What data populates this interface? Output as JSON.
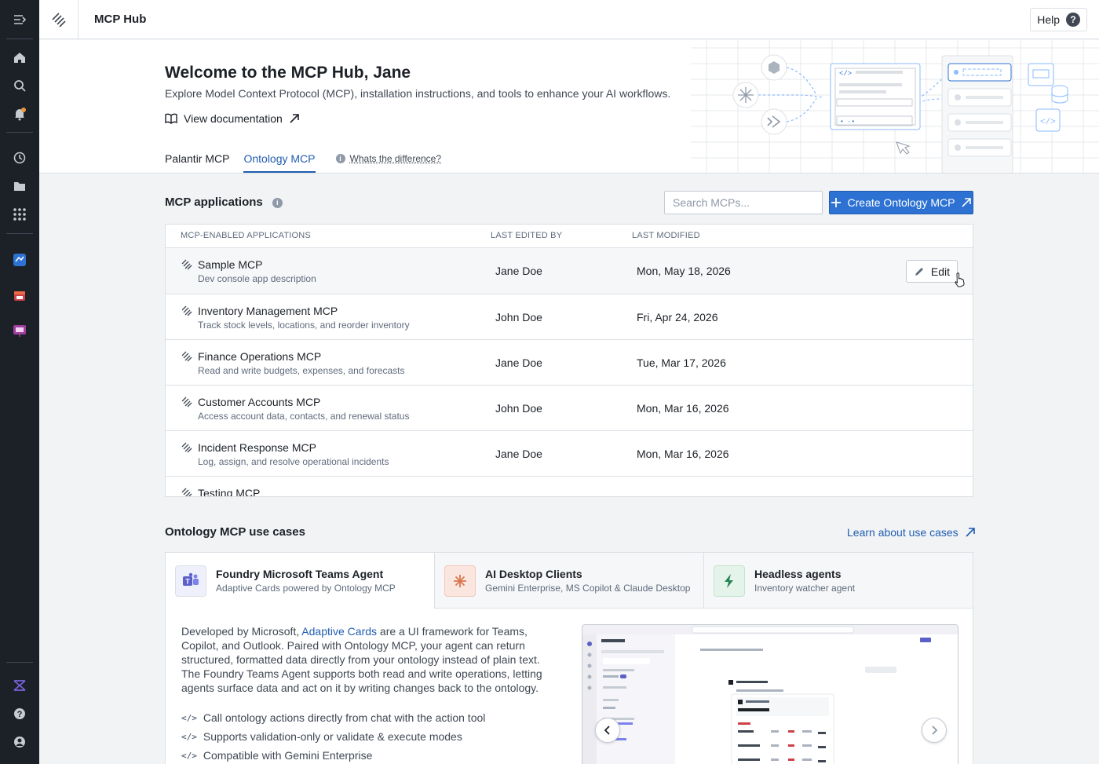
{
  "app": {
    "title": "MCP Hub",
    "help_label": "Help"
  },
  "hero": {
    "title": "Welcome to the MCP Hub, Jane",
    "subtitle": "Explore Model Context Protocol (MCP), installation instructions, and tools to enhance your AI workflows.",
    "docs_link": "View documentation",
    "tabs": [
      "Palantir MCP",
      "Ontology MCP"
    ],
    "active_tab": "Ontology MCP",
    "difference_link": "Whats the difference?"
  },
  "applications": {
    "title": "MCP applications",
    "search_placeholder": "Search MCPs...",
    "create_label": "Create Ontology MCP",
    "columns": [
      "MCP-ENABLED APPLICATIONS",
      "LAST EDITED BY",
      "LAST MODIFIED"
    ],
    "edit_label": "Edit",
    "rows": [
      {
        "name": "Sample MCP",
        "desc": "Dev console app description",
        "by": "Jane Doe",
        "modified": "Mon, May 18, 2026"
      },
      {
        "name": "Inventory Management MCP",
        "desc": "Track stock levels, locations, and reorder inventory",
        "by": "John Doe",
        "modified": "Fri, Apr 24, 2026"
      },
      {
        "name": "Finance Operations MCP",
        "desc": "Read and write budgets, expenses, and forecasts",
        "by": "Jane Doe",
        "modified": "Tue, Mar 17, 2026"
      },
      {
        "name": "Customer Accounts MCP",
        "desc": "Access account data, contacts, and renewal status",
        "by": "John Doe",
        "modified": "Mon, Mar 16, 2026"
      },
      {
        "name": "Incident Response MCP",
        "desc": "Log, assign, and resolve operational incidents",
        "by": "Jane Doe",
        "modified": "Mon, Mar 16, 2026"
      },
      {
        "name": "Testing MCP",
        "desc": "",
        "by": "",
        "modified": ""
      }
    ]
  },
  "use_cases": {
    "title": "Ontology MCP use cases",
    "learn_link": "Learn about use cases",
    "tabs": [
      {
        "title": "Foundry Microsoft Teams Agent",
        "sub": "Adaptive Cards powered by Ontology MCP",
        "icon": "teams-icon"
      },
      {
        "title": "AI Desktop Clients",
        "sub": "Gemini Enterprise, MS Copilot & Claude Desktop",
        "icon": "sparkle-icon"
      },
      {
        "title": "Headless agents",
        "sub": "Inventory watcher agent",
        "icon": "bolt-icon"
      }
    ],
    "body_prefix": "Developed by Microsoft, ",
    "body_link": "Adaptive Cards",
    "body_rest": " are a UI framework for Teams, Copilot, and Outlook. Paired with Ontology MCP, your agent can return structured, formatted data directly from your ontology instead of plain text. The Foundry Teams Agent supports both read and write operations, letting agents surface data and act on it by writing changes back to the ontology.",
    "bullets": [
      "Call ontology actions directly from chat with the action tool",
      "Supports validation-only or validate & execute modes",
      "Compatible with Gemini Enterprise"
    ]
  },
  "colors": {
    "accent": "#2d72d2",
    "sidebar": "#1c2127",
    "link": "#215db0"
  }
}
